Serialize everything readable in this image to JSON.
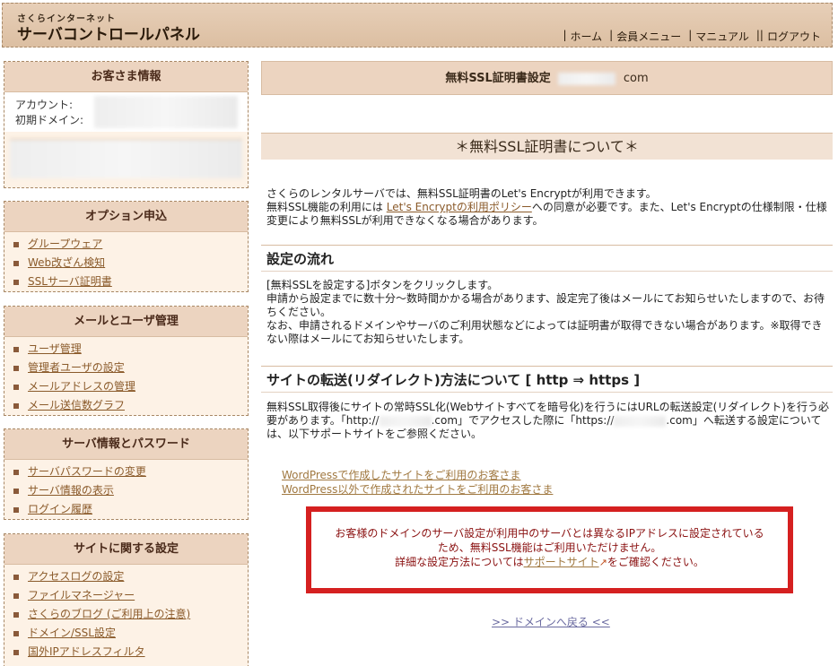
{
  "header": {
    "logo_small": "さくらインターネット",
    "logo_big": "サーバコントロールパネル",
    "nav": [
      "ホーム",
      "会員メニュー",
      "マニュアル",
      "ログアウト"
    ]
  },
  "sidebar": {
    "customer": {
      "title": "お客さま情報",
      "account_label": "アカウント:",
      "domain_label": "初期ドメイン:"
    },
    "option": {
      "title": "オプション申込",
      "items": [
        "グループウェア",
        "Web改ざん検知",
        "SSLサーバ証明書"
      ]
    },
    "mail": {
      "title": "メールとユーザ管理",
      "items": [
        "ユーザ管理",
        "管理者ユーザの設定",
        "メールアドレスの管理",
        "メール送信数グラフ"
      ]
    },
    "server": {
      "title": "サーバ情報とパスワード",
      "items": [
        "サーバパスワードの変更",
        "サーバ情報の表示",
        "ログイン履歴"
      ]
    },
    "site": {
      "title": "サイトに関する設定",
      "items": [
        "アクセスログの設定",
        "ファイルマネージャー",
        "さくらのブログ (ご利用上の注意)",
        "ドメイン/SSL設定",
        "国外IPアドレスフィルタ"
      ]
    }
  },
  "main": {
    "title_prefix": "無料SSL証明書設定",
    "title_suffix": "com",
    "about_heading": "＊無料SSL証明書について＊",
    "intro_1": "さくらのレンタルサーバでは、無料SSL証明書のLet's Encryptが利用できます。",
    "intro_2a": "無料SSL機能の利用には ",
    "intro_policy_link": "Let's Encryptの利用ポリシー",
    "intro_2b": "への同意が必要です。また、Let's Encryptの仕様制限・仕様変更により無料SSLが利用できなくなる場合があります。",
    "flow_heading": "設定の流れ",
    "flow_1": "[無料SSLを設定する]ボタンをクリックします。",
    "flow_2": "申請から設定までに数十分～数時間かかる場合があります、設定完了後はメールにてお知らせいたしますので、お待ちください。",
    "flow_3": "なお、申請されるドメインやサーバのご利用状態などによっては証明書が取得できない場合があります。※取得できない際はメールにてお知らせいたします。",
    "redirect_heading": "サイトの転送(リダイレクト)方法について [ http ⇒ https ]",
    "redirect_1": "無料SSL取得後にサイトの常時SSL化(Webサイトすべてを暗号化)を行うにはURLの転送設定(リダイレクト)を行う必要があります。「http://",
    "redirect_1b": ".com」でアクセスした際に「https://",
    "redirect_1c": ".com」へ転送する設定については、以下サポートサイトをご参照ください。",
    "link_wp": "WordPressで作成したサイトをご利用のお客さま",
    "link_non_wp": "WordPress以外で作成されたサイトをご利用のお客さま",
    "alert_1": "お客様のドメインのサーバ設定が利用中のサーバとは異なるIPアドレスに設定されているため、無料SSL機能はご利用いただけません。",
    "alert_2a": "詳細な設定方法については",
    "alert_link": "サポートサイト",
    "alert_2b": "をご確認ください。",
    "back_link": ">> ドメインへ戻る <<"
  }
}
